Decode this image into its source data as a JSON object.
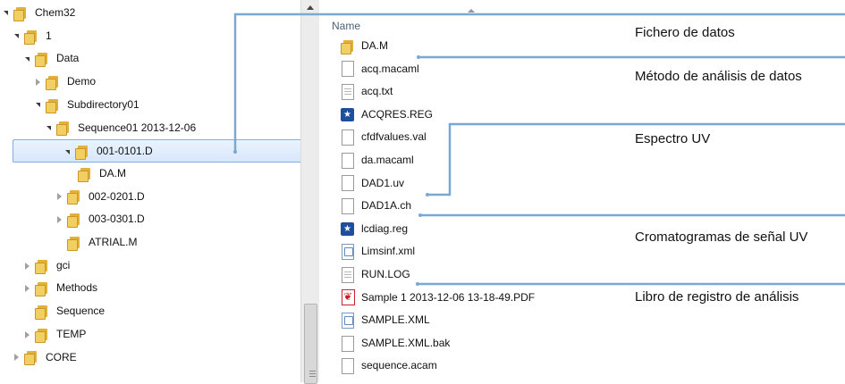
{
  "tree": {
    "items": [
      {
        "label": "Chem32",
        "depth": 0,
        "state": "open"
      },
      {
        "label": "1",
        "depth": 1,
        "state": "open"
      },
      {
        "label": "Data",
        "depth": 2,
        "state": "open"
      },
      {
        "label": "Demo",
        "depth": 3,
        "state": "closed"
      },
      {
        "label": "Subdirectory01",
        "depth": 3,
        "state": "open"
      },
      {
        "label": "Sequence01 2013-12-06",
        "depth": 4,
        "state": "open"
      },
      {
        "label": "001-0101.D",
        "depth": 5,
        "state": "open",
        "selected": true
      },
      {
        "label": "DA.M",
        "depth": 6,
        "state": "none"
      },
      {
        "label": "002-0201.D",
        "depth": 5,
        "state": "closed"
      },
      {
        "label": "003-0301.D",
        "depth": 5,
        "state": "closed"
      },
      {
        "label": "ATRIAL.M",
        "depth": 5,
        "state": "none"
      },
      {
        "label": "gci",
        "depth": 2,
        "state": "closed"
      },
      {
        "label": "Methods",
        "depth": 2,
        "state": "closed"
      },
      {
        "label": "Sequence",
        "depth": 2,
        "state": "none"
      },
      {
        "label": "TEMP",
        "depth": 2,
        "state": "closed"
      },
      {
        "label": "CORE",
        "depth": 1,
        "state": "closed"
      }
    ]
  },
  "files": {
    "header": "Name",
    "items": [
      {
        "name": "DA.M",
        "icon": "folder-icon"
      },
      {
        "name": "acq.macaml",
        "icon": "file-icon"
      },
      {
        "name": "acq.txt",
        "icon": "text-file-icon"
      },
      {
        "name": "ACQRES.REG",
        "icon": "registry-file-icon"
      },
      {
        "name": "cfdfvalues.val",
        "icon": "file-icon"
      },
      {
        "name": "da.macaml",
        "icon": "file-icon"
      },
      {
        "name": "DAD1.uv",
        "icon": "file-icon"
      },
      {
        "name": "DAD1A.ch",
        "icon": "file-icon"
      },
      {
        "name": "lcdiag.reg",
        "icon": "registry-file-icon"
      },
      {
        "name": "Limsinf.xml",
        "icon": "xml-file-icon"
      },
      {
        "name": "RUN.LOG",
        "icon": "text-file-icon"
      },
      {
        "name": "Sample 1 2013-12-06 13-18-49.PDF",
        "icon": "pdf-file-icon"
      },
      {
        "name": "SAMPLE.XML",
        "icon": "xml-file-icon"
      },
      {
        "name": "SAMPLE.XML.bak",
        "icon": "file-icon"
      },
      {
        "name": "sequence.acam",
        "icon": "file-icon"
      }
    ]
  },
  "callouts": {
    "data_file": "Fichero de datos",
    "analysis_method": "Método de análisis de datos",
    "uv_spectrum": "Espectro UV",
    "uv_chromatograms": "Cromatogramas de señal UV",
    "run_log": "Libro de registro de análisis"
  },
  "colors": {
    "callout_line": "#7aa8d4",
    "selection_border": "#84acdd",
    "folder": "#f2cf62"
  }
}
